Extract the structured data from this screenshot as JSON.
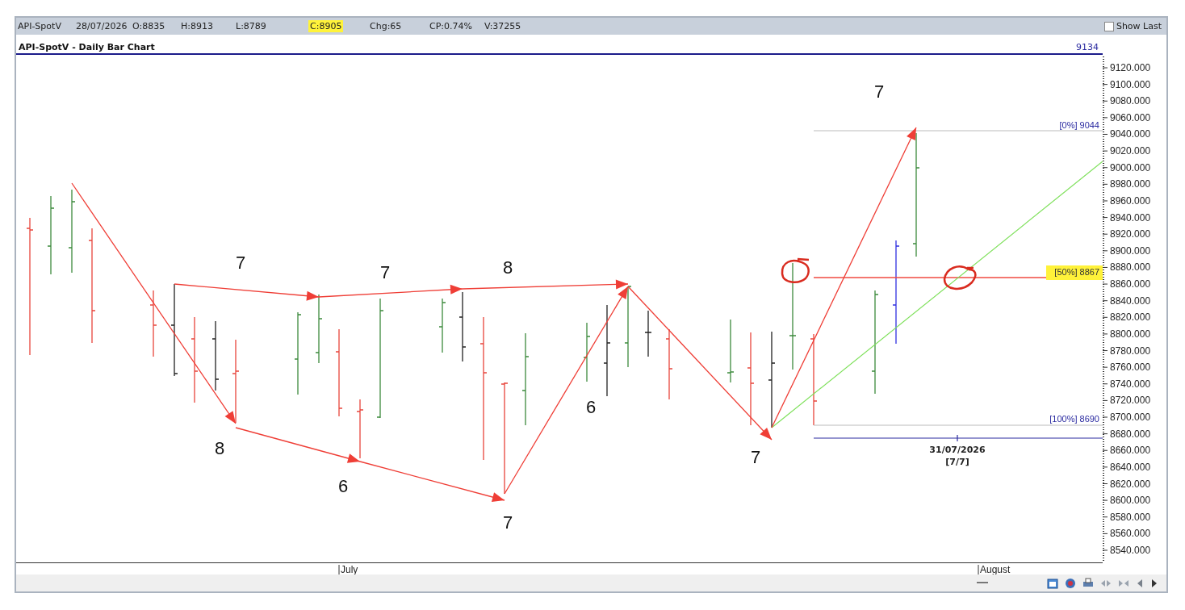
{
  "quote": [
    {
      "text": "API-SpotV",
      "highlighted": false
    },
    {
      "text": "28/07/2026",
      "highlighted": false
    },
    {
      "text": "O:8835",
      "highlighted": false
    },
    {
      "text": "H:8913",
      "highlighted": false
    },
    {
      "text": "L:8789",
      "highlighted": false
    },
    {
      "text": "C:8905",
      "highlighted": true
    },
    {
      "text": "Chg:65",
      "highlighted": false
    },
    {
      "text": "CP:0.74%",
      "highlighted": false
    },
    {
      "text": "V:37255",
      "highlighted": false
    }
  ],
  "show_last": {
    "label": "Show Last",
    "checked": false
  },
  "chart": {
    "title": "API-SpotV - Daily Bar Chart",
    "top_value": "9134",
    "price_axis": [
      "9120.000",
      "9100.000",
      "9080.000",
      "9060.000",
      "9040.000",
      "9020.000",
      "9000.000",
      "8980.000",
      "8960.000",
      "8940.000",
      "8920.000",
      "8900.000",
      "8880.000",
      "8860.000",
      "8840.000",
      "8820.000",
      "8800.000",
      "8780.000",
      "8760.000",
      "8740.000",
      "8720.000",
      "8700.000",
      "8680.000",
      "8660.000",
      "8640.000",
      "8620.000",
      "8600.000",
      "8580.000",
      "8560.000",
      "8540.000"
    ],
    "time_axis": [
      "July",
      "August"
    ],
    "wave_labels": [
      "7",
      "7",
      "8",
      "8",
      "6",
      "7",
      "6",
      "7",
      "7"
    ],
    "fib_levels": [
      {
        "label": "[0%] 9044",
        "highlighted": false
      },
      {
        "label": "[50%] 8867",
        "highlighted": true
      },
      {
        "label": "[100%] 8690",
        "highlighted": false
      }
    ],
    "date_marker": {
      "date": "31/07/2026",
      "count": "[7/7]"
    }
  }
}
